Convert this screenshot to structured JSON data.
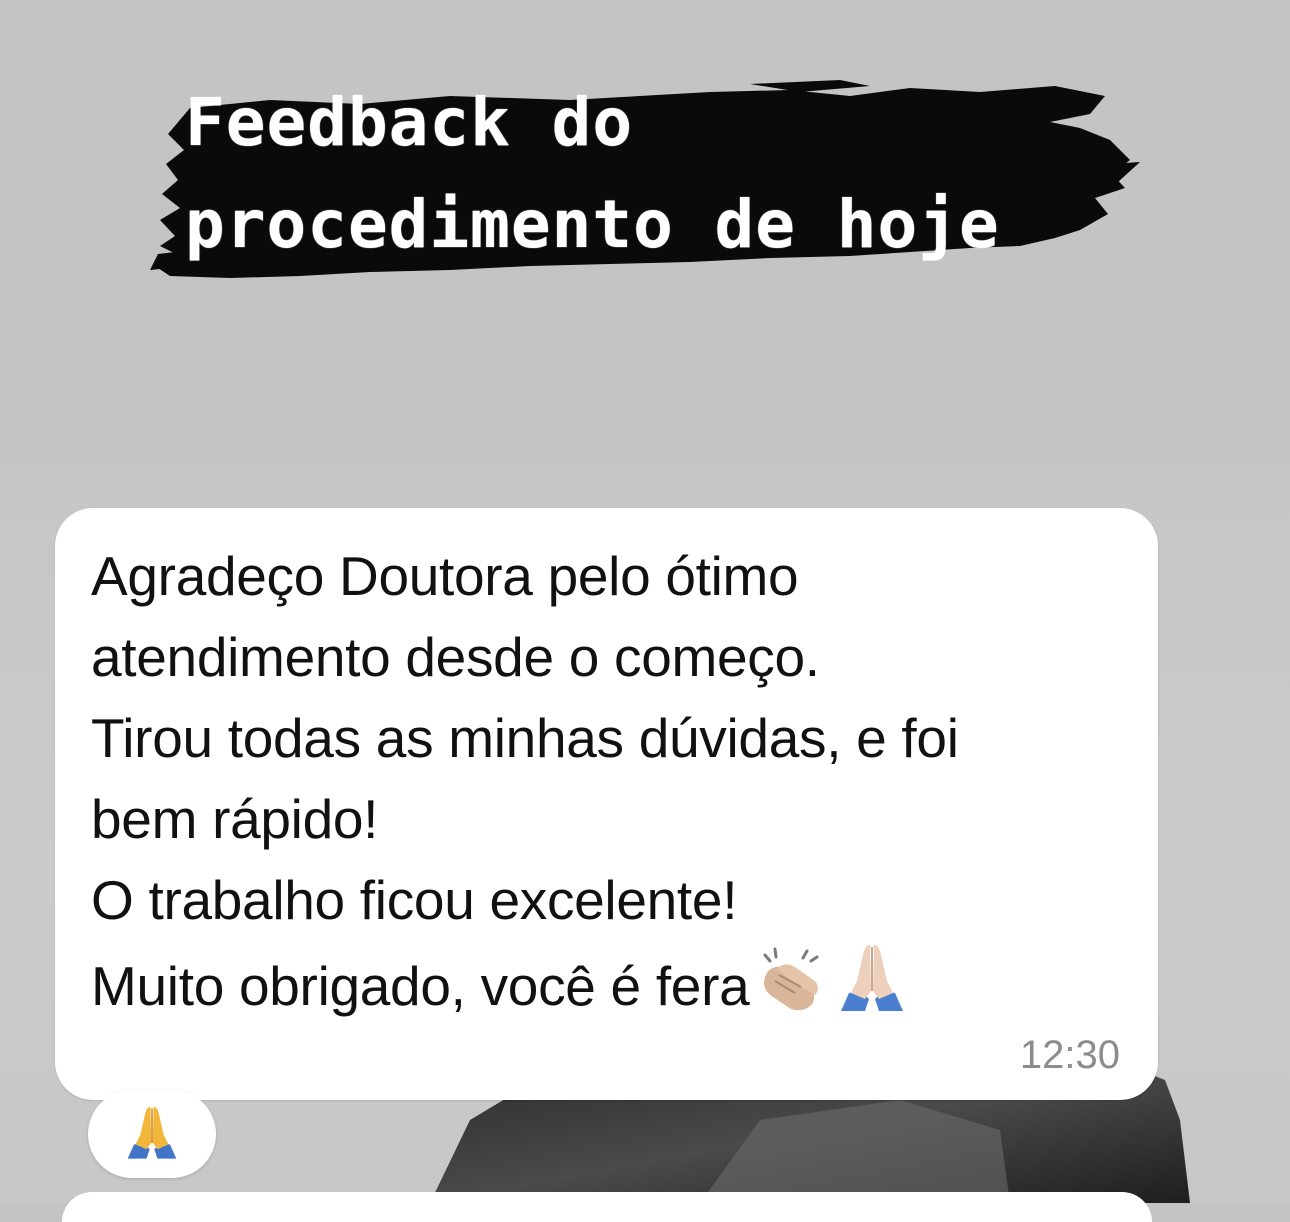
{
  "header": {
    "title_line1": "Feedback do",
    "title_line2": "procedimento de hoje"
  },
  "message": {
    "lines": [
      "Agradeço Doutora pelo ótimo",
      "atendimento desde o começo.",
      "Tirou todas as minhas dúvidas, e foi",
      "bem rápido!",
      "O trabalho ficou excelente!",
      "Muito obrigado, você é fera"
    ],
    "emojis": [
      "clapping-hands-icon",
      "folded-hands-icon"
    ],
    "time": "12:30"
  },
  "reaction": {
    "emoji": "folded-hands-icon"
  },
  "colors": {
    "background": "#c4c4c4",
    "bubble": "#ffffff",
    "text": "#111111",
    "timestamp": "#8c8c8c",
    "brush": "#0a0a0a"
  }
}
